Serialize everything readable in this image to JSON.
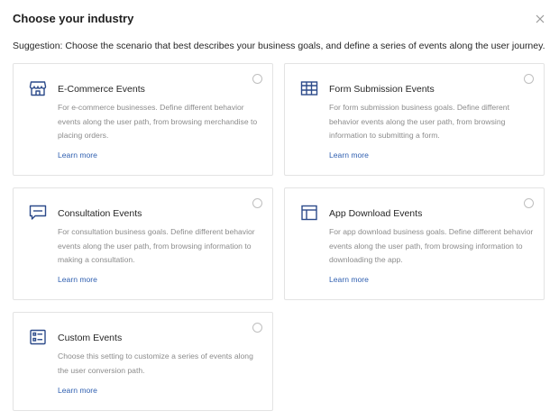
{
  "dialog": {
    "title": "Choose your industry",
    "suggestion": "Suggestion: Choose the scenario that best describes your business goals, and define a series of events along the user journey."
  },
  "icons": {
    "close": "close-icon"
  },
  "colors": {
    "icon": "#2c4a8a",
    "link": "#2f5fb0",
    "border": "#e3e3e3",
    "desc": "#8c8c8c"
  },
  "cards": [
    {
      "title": "E-Commerce Events",
      "icon": "store-icon",
      "description": "For e-commerce businesses. Define different behavior events along the user path, from browsing merchandise to placing orders.",
      "link": "Learn more",
      "selected": false
    },
    {
      "title": "Form Submission Events",
      "icon": "table-icon",
      "description": "For form submission business goals. Define different behavior events along the user path, from browsing information to submitting a form.",
      "link": "Learn more",
      "selected": false
    },
    {
      "title": "Consultation Events",
      "icon": "chat-icon",
      "description": "For consultation business goals. Define different behavior events along the user path, from browsing information to making a consultation.",
      "link": "Learn more",
      "selected": false
    },
    {
      "title": "App Download Events",
      "icon": "layout-icon",
      "description": "For app download business goals. Define different behavior events along the user path, from browsing information to downloading the app.",
      "link": "Learn more",
      "selected": false
    },
    {
      "title": "Custom Events",
      "icon": "list-icon",
      "description": "Choose this setting to customize a series of events along the user conversion path.",
      "link": "Learn more",
      "selected": false
    }
  ]
}
